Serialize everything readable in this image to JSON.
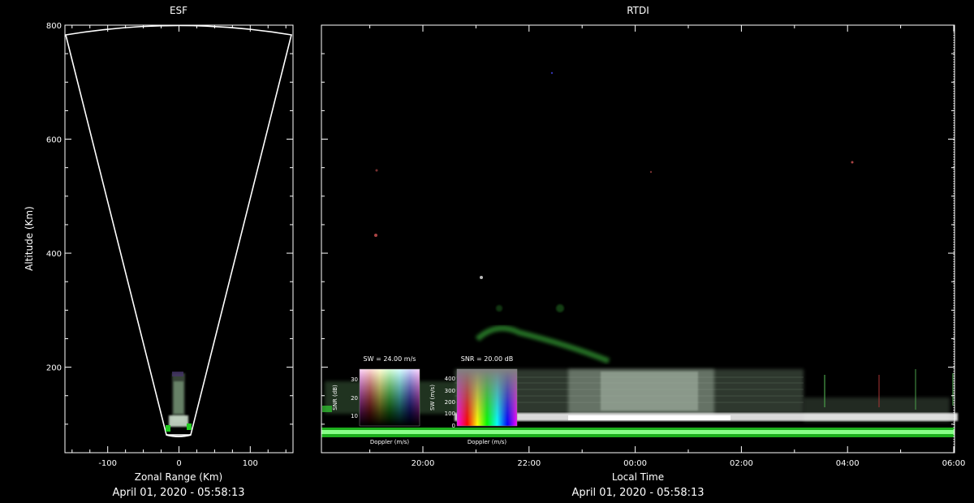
{
  "chart_data": [
    {
      "type": "heatmap",
      "title": "ESF",
      "xlabel": "Zonal Range (Km)",
      "ylabel": "Altitude (Km)",
      "xlim": [
        -160,
        160
      ],
      "ylim": [
        50,
        800
      ],
      "x_ticks": [
        -100,
        0,
        100
      ],
      "y_ticks": [
        200,
        400,
        600,
        800
      ],
      "timestamp": "April 01, 2020 - 05:58:13",
      "beam_sector": {
        "half_angle_deg": 12,
        "max_altitude": 800,
        "min_altitude": 78
      }
    },
    {
      "type": "heatmap",
      "title": "RTDI",
      "xlabel": "Local Time",
      "ylim": [
        50,
        800
      ],
      "x_ticks": [
        "20:00",
        "22:00",
        "00:00",
        "02:00",
        "04:00",
        "06:00"
      ],
      "timestamp": "April 01, 2020 - 05:58:13",
      "colorbars": [
        {
          "title": "SW = 24.00 m/s",
          "xlabel": "Doppler (m/s)",
          "ylabel": "SNR (dB)",
          "y_ticks": [
            "30",
            "20",
            "10"
          ]
        },
        {
          "title": "SNR = 20.00 dB",
          "xlabel": "Doppler (m/s)",
          "ylabel": "SW (m/s)",
          "y_ticks": [
            "400",
            "300",
            "200",
            "100",
            "0"
          ]
        }
      ]
    }
  ]
}
